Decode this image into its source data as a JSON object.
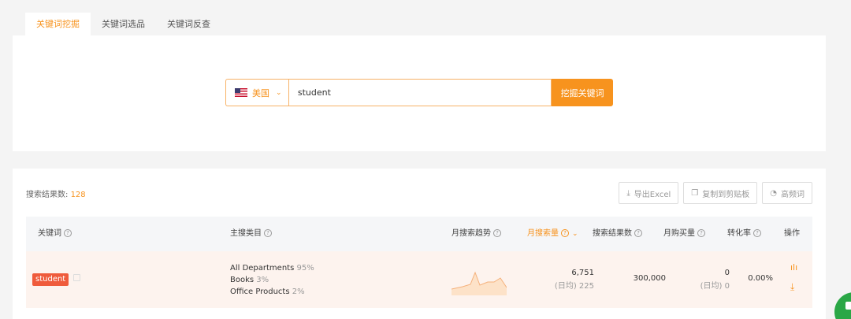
{
  "tabs": [
    {
      "label": "关键词挖掘",
      "active": true
    },
    {
      "label": "关键词选品",
      "active": false
    },
    {
      "label": "关键词反查",
      "active": false
    }
  ],
  "search": {
    "country": "美国",
    "keyword": "student",
    "button": "挖掘关键词",
    "flag_icon": "us-flag-icon"
  },
  "results": {
    "count_label": "搜索结果数:",
    "count_value": "128",
    "actions": {
      "export": "导出Excel",
      "copy": "复制到剪贴板",
      "high_freq": "高频词"
    },
    "headers": {
      "keyword": "关键词",
      "category": "主搜类目",
      "trend": "月搜索趋势",
      "volume": "月搜索量",
      "result_count": "搜索结果数",
      "purchase": "月购买量",
      "conversion": "转化率",
      "operation": "操作"
    },
    "rows": [
      {
        "keyword": "student",
        "categories": [
          {
            "name": "All Departments",
            "pct": "95%"
          },
          {
            "name": "Books",
            "pct": "3%"
          },
          {
            "name": "Office Products",
            "pct": "2%"
          }
        ],
        "volume": "6,751",
        "volume_daily": "(日均) 225",
        "result_count": "300,000",
        "purchase": "0",
        "purchase_daily": "(日均) 0",
        "conversion": "0.00%"
      }
    ]
  },
  "colors": {
    "accent": "#f7931e",
    "tag": "#ef5b3c",
    "row_highlight": "#fdf3ee"
  }
}
